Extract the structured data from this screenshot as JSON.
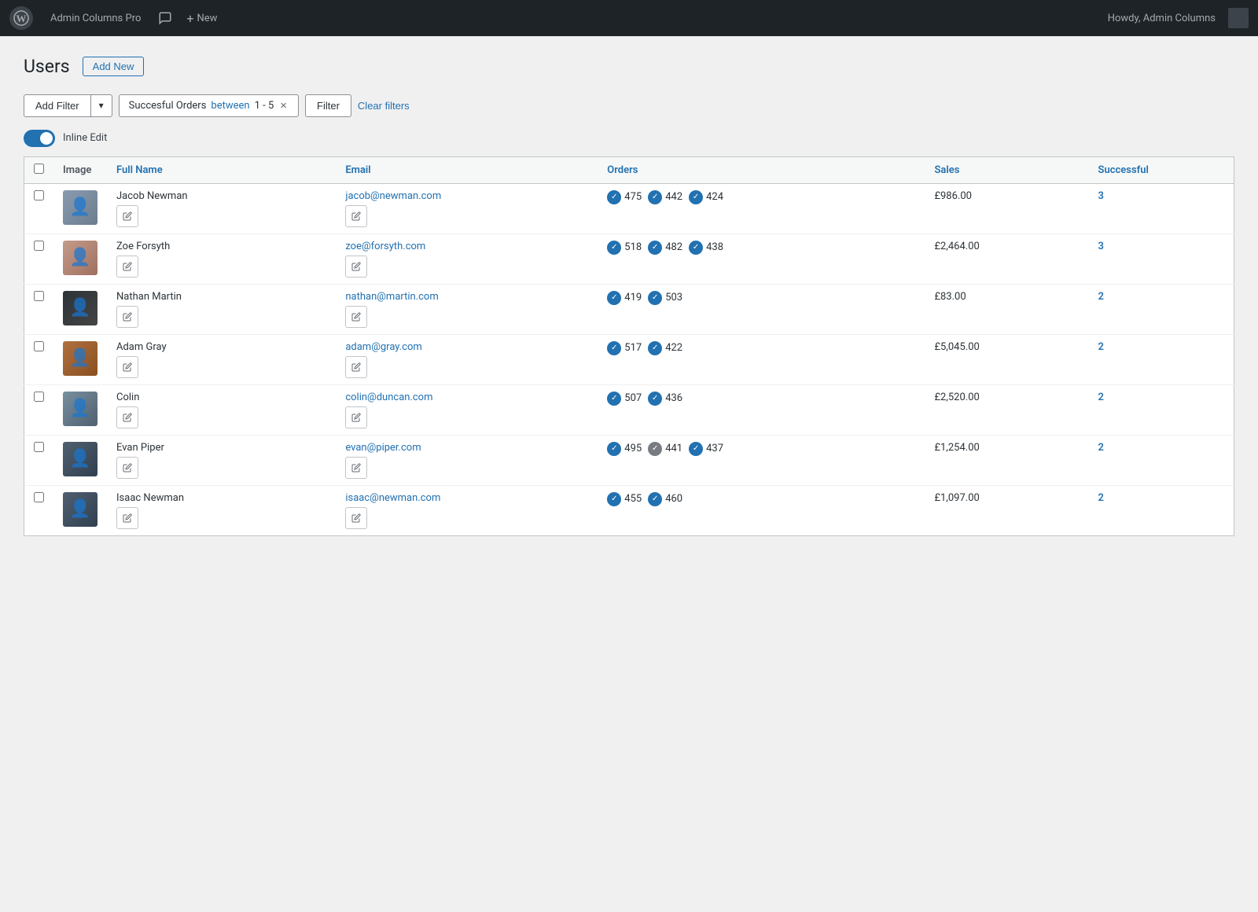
{
  "adminbar": {
    "wp_logo": "W",
    "plugin_name": "Admin Columns Pro",
    "new_label": "New",
    "howdy": "Howdy, Admin Columns"
  },
  "page": {
    "title": "Users",
    "add_new_label": "Add New"
  },
  "filter_bar": {
    "add_filter_label": "Add Filter",
    "dropdown_arrow": "▾",
    "chip_label": "Succesful Orders",
    "chip_between": "between",
    "chip_range": "1 - 5",
    "chip_close": "×",
    "filter_btn_label": "Filter",
    "clear_filters_label": "Clear filters"
  },
  "inline_edit": {
    "label": "Inline Edit"
  },
  "table": {
    "columns": [
      "",
      "Image",
      "Full Name",
      "Email",
      "Orders",
      "Sales",
      "Successful"
    ],
    "rows": [
      {
        "id": 1,
        "avatar_class": "av1",
        "name": "Jacob Newman",
        "email": "jacob@newman.com",
        "orders": [
          {
            "num": "475",
            "type": "check"
          },
          {
            "num": "442",
            "type": "check"
          },
          {
            "num": "424",
            "type": "check"
          }
        ],
        "sales": "£986.00",
        "successful": "3"
      },
      {
        "id": 2,
        "avatar_class": "av2",
        "name": "Zoe Forsyth",
        "email": "zoe@forsyth.com",
        "orders": [
          {
            "num": "518",
            "type": "check"
          },
          {
            "num": "482",
            "type": "check"
          },
          {
            "num": "438",
            "type": "check"
          }
        ],
        "sales": "£2,464.00",
        "successful": "3"
      },
      {
        "id": 3,
        "avatar_class": "av3",
        "name": "Nathan Martin",
        "email": "nathan@martin.com",
        "orders": [
          {
            "num": "419",
            "type": "check"
          },
          {
            "num": "503",
            "type": "check"
          }
        ],
        "sales": "£83.00",
        "successful": "2"
      },
      {
        "id": 4,
        "avatar_class": "av4",
        "name": "Adam Gray",
        "email": "adam@gray.com",
        "orders": [
          {
            "num": "517",
            "type": "check"
          },
          {
            "num": "422",
            "type": "check"
          }
        ],
        "sales": "£5,045.00",
        "successful": "2"
      },
      {
        "id": 5,
        "avatar_class": "av5",
        "name": "Colin",
        "email": "colin@duncan.com",
        "orders": [
          {
            "num": "507",
            "type": "check"
          },
          {
            "num": "436",
            "type": "check"
          }
        ],
        "sales": "£2,520.00",
        "successful": "2"
      },
      {
        "id": 6,
        "avatar_class": "av6",
        "name": "Evan Piper",
        "email": "evan@piper.com",
        "orders": [
          {
            "num": "495",
            "type": "check"
          },
          {
            "num": "441",
            "type": "pending"
          },
          {
            "num": "437",
            "type": "check"
          }
        ],
        "sales": "£1,254.00",
        "successful": "2"
      },
      {
        "id": 7,
        "avatar_class": "av7",
        "name": "Isaac Newman",
        "email": "isaac@newman.com",
        "orders": [
          {
            "num": "455",
            "type": "check"
          },
          {
            "num": "460",
            "type": "check"
          }
        ],
        "sales": "£1,097.00",
        "successful": "2"
      }
    ]
  }
}
